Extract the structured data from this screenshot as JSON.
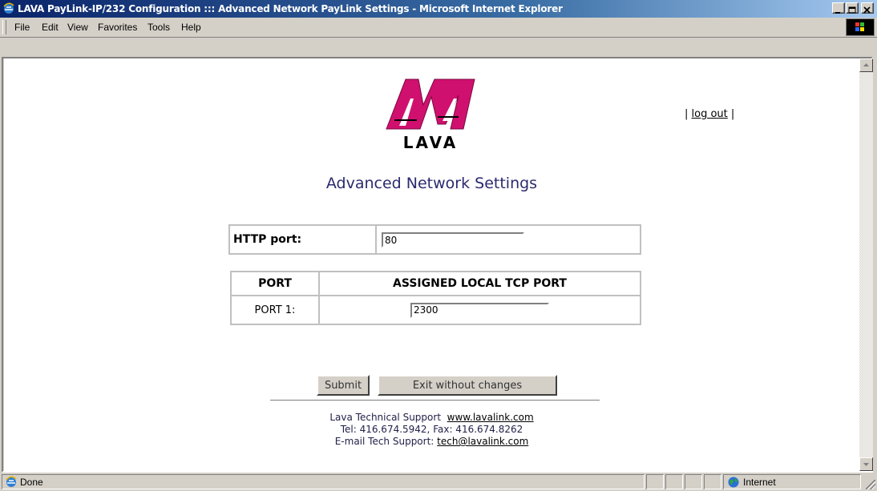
{
  "window": {
    "title": "LAVA PayLink-IP/232 Configuration ::: Advanced Network PayLink Settings - Microsoft Internet Explorer"
  },
  "menu": [
    "File",
    "Edit",
    "View",
    "Favorites",
    "Tools",
    "Help"
  ],
  "header": {
    "logo_text": "LAVA",
    "logout_prefix": "|",
    "logout_label": "log out",
    "logout_suffix": "|",
    "title": "Advanced Network Settings"
  },
  "http": {
    "label": "HTTP port:",
    "value": "80"
  },
  "ports": {
    "headers": [
      "PORT",
      "ASSIGNED LOCAL TCP PORT"
    ],
    "rows": [
      {
        "label": "PORT 1:",
        "value": "2300"
      }
    ]
  },
  "buttons": {
    "submit": "Submit",
    "exit": "Exit without changes"
  },
  "footer": {
    "support_label": "Lava Technical Support",
    "support_link": "www.lavalink.com",
    "phone": "Tel: 416.674.5942, Fax: 416.674.8262",
    "email_label": "E-mail Tech Support:",
    "email_link": "tech@lavalink.com"
  },
  "status": {
    "text": "Done",
    "zone": "Internet"
  },
  "colors": {
    "logo": "#d0106e",
    "heading": "#2a2a6e",
    "titlebar": "#0a246a"
  }
}
